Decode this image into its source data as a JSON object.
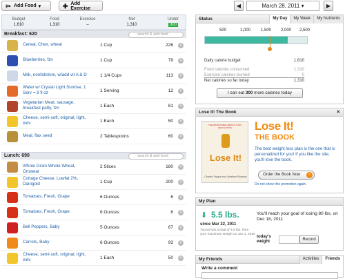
{
  "toolbar": {
    "add_food": "Add Food",
    "add_exercise": "Add Exercise",
    "prev": "◀",
    "next": "▶",
    "date": "March 28, 2011",
    "date_caret": "▾"
  },
  "summary": {
    "cols": [
      {
        "label": "Budget",
        "value": "1,610"
      },
      {
        "label": "Food",
        "value": "1,310"
      },
      {
        "label": "Exercise",
        "value": "–"
      },
      {
        "label": "Net",
        "value": "1,310"
      },
      {
        "label": "Under",
        "value": "300"
      }
    ]
  },
  "breakfast": {
    "title": "Breakfast: 620",
    "search_placeholder": "search & add food",
    "items": [
      {
        "name": "Cereal, Chex, wheat",
        "qty": "1 Cup",
        "cal": "226",
        "icon": "cereal-bowl-icon",
        "color": "#d9b24a"
      },
      {
        "name": "Blueberries, fzn",
        "qty": "1 Cup",
        "cal": "79",
        "icon": "blueberry-icon",
        "color": "#2d4fb0"
      },
      {
        "name": "Milk, nonfat/skim, w/add vit A & D",
        "qty": "1 1/4 Cups",
        "cal": "113",
        "icon": "milk-carton-icon",
        "color": "#cfd8e6"
      },
      {
        "name": "Water w/ Crystal Light Sunrise, 1 Serv = 8 fl oz",
        "qty": "1 Serving",
        "cal": "12",
        "icon": "drink-icon",
        "color": "#e46a2a"
      },
      {
        "name": "Vegetarian Meat, sausage, breakfast patty, fzn",
        "qty": "1 Each",
        "cal": "81",
        "icon": "sausage-icon",
        "color": "#b0452a"
      },
      {
        "name": "Cheese, semi-soft, original, light, indv",
        "qty": "1 Each",
        "cal": "50",
        "icon": "cheese-icon",
        "color": "#f2c62a"
      },
      {
        "name": "Meal, flax seed",
        "qty": "2 Tablespoons",
        "cal": "60",
        "icon": "grain-icon",
        "color": "#b8903a"
      }
    ]
  },
  "lunch": {
    "title": "Lunch: 690",
    "search_placeholder": "search & add food",
    "items": [
      {
        "name": "Whole Grain Whole Wheat, Oroweat",
        "qty": "2 Slices",
        "cal": "180",
        "icon": "bread-icon",
        "color": "#c58a44"
      },
      {
        "name": "Cottage Cheese, Lowfat 2%, Dairigold",
        "qty": "1 Cup",
        "cal": "200",
        "icon": "cheese-icon",
        "color": "#f2c62a"
      },
      {
        "name": "Tomatoes, Fresh, Grape",
        "qty": "6 Ounces",
        "cal": "6",
        "icon": "tomato-icon",
        "color": "#d63018"
      },
      {
        "name": "Tomatoes, Fresh, Grape",
        "qty": "6 Ounces",
        "cal": "6",
        "icon": "tomato-icon",
        "color": "#d63018"
      },
      {
        "name": "Bell Peppers, Baby",
        "qty": "5 Ounces",
        "cal": "67",
        "icon": "pepper-icon",
        "color": "#d02020"
      },
      {
        "name": "Carrots, Baby",
        "qty": "6 Ounces",
        "cal": "93",
        "icon": "carrot-icon",
        "color": "#f08a1a"
      },
      {
        "name": "Cheese, semi-soft, original, light, indv",
        "qty": "1 Each",
        "cal": "50",
        "icon": "cheese-icon",
        "color": "#f2c62a"
      }
    ]
  },
  "status": {
    "title": "Status",
    "tabs": [
      "My Day",
      "My Week",
      "My Nutrients"
    ],
    "ticks": [
      "500",
      "1,000",
      "1,500",
      "2,000",
      "2,500"
    ],
    "progress_fraction": 0.81,
    "rows": [
      {
        "label": "Daily calorie budget",
        "value": "1,610"
      },
      {
        "label": "Food calories consumed",
        "value": "1,310"
      },
      {
        "label": "Exercise calories burned",
        "value": "0"
      },
      {
        "label": "Net calories so far today",
        "value": "1,310"
      }
    ],
    "button_pre": "I can eat ",
    "button_num": "300",
    "button_post": " more calories today"
  },
  "book": {
    "title": "Lose It! The Book",
    "cover_top": "THE APPROVABLE WEIGHT LOSS REVOLUTION",
    "cover_title": "Lose It!",
    "cover_authors": "Charles Teague and Jonathan Edwards",
    "big_title": "Lose It!",
    "big_sub": "THE BOOK",
    "desc": "The best weight loss plan is the one that is personalized for you! If you like the site, you'll love the book.",
    "order": "Order the Book Now",
    "no_show": "Do not show this promotion again."
  },
  "plan": {
    "title": "My Plan",
    "lost": "5.5 lbs.",
    "since": "since Mar 22, 2011",
    "detail": "You've lost a total of 4.5 lbs. from your maximum weight on Jan 1, 2010",
    "goal": "You'll reach your goal of losing 80 lbs. on Dec 18, 2011",
    "today_label": "today's weight",
    "record": "Record"
  },
  "friends": {
    "title": "My Friends",
    "tabs": [
      "Activities",
      "Friends"
    ],
    "write": "Write a comment"
  },
  "colors": {
    "accent": "#1f5fa8",
    "under": "#2eaa3e",
    "bar": "#3fb8a0"
  }
}
